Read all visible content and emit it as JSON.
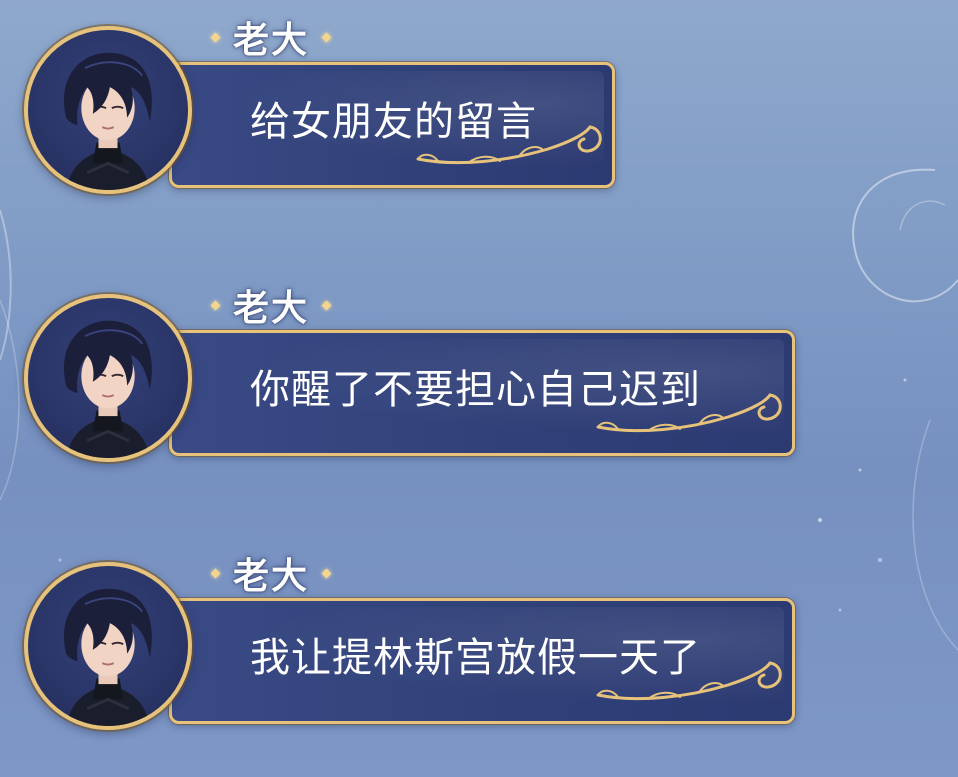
{
  "messages": [
    {
      "sender": "老大",
      "text": "给女朋友的留言"
    },
    {
      "sender": "老大",
      "text": "你醒了不要担心自己迟到"
    },
    {
      "sender": "老大",
      "text": "我让提林斯宫放假一天了"
    }
  ]
}
